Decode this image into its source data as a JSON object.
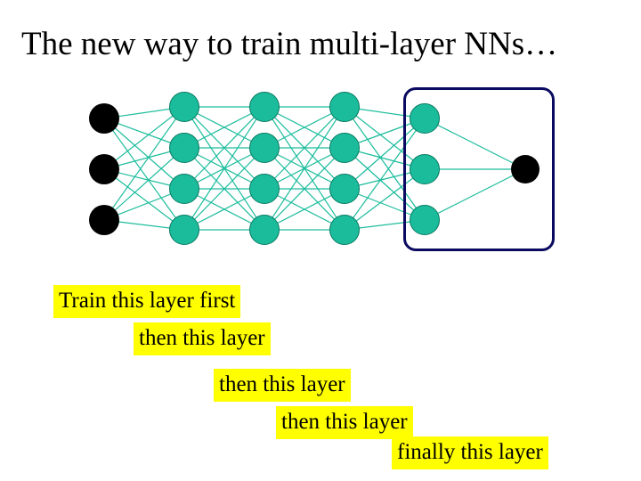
{
  "title": "The new way to train multi-layer NNs…",
  "captions": {
    "c1": "Train this layer first",
    "c2": "then this layer",
    "c3": "then this layer",
    "c4": "then this layer",
    "c5": "finally this layer"
  },
  "network": {
    "layers": [
      3,
      4,
      4,
      4,
      3,
      1
    ],
    "colors": {
      "input": "#000000",
      "hidden": "#1abc9c",
      "output": "#000000",
      "edge": "#1abc9c",
      "box": "#0a0a60"
    }
  }
}
